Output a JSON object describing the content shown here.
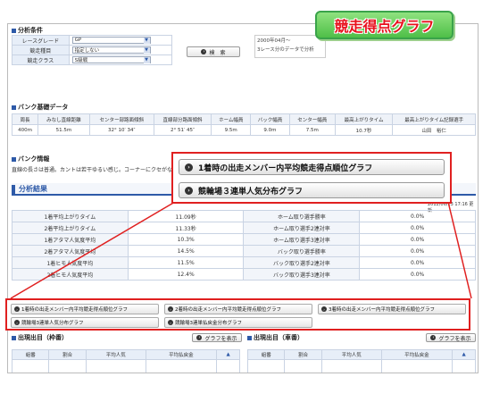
{
  "badge": "競走得点グラフ",
  "sections": {
    "analysis_cond": "分析条件",
    "bank_data": "バンク基礎データ",
    "bank_info": "バンク情報",
    "analysis_result": "分析結果"
  },
  "conditions": [
    {
      "label": "レースグレード",
      "value": "GP"
    },
    {
      "label": "競走種目",
      "value": "指定しない"
    },
    {
      "label": "競走クラス",
      "value": "S級戦"
    }
  ],
  "search_btn": "検　索",
  "period": {
    "line1": "2000年04月〜",
    "line2": "3レース分のデータで分析"
  },
  "bank": {
    "headers": [
      "周長",
      "みなし直線距離",
      "センター部路面傾斜",
      "直線部分路面傾斜",
      "ホーム幅員",
      "バック幅員",
      "センター幅員",
      "最高上がりタイム",
      "最高上がりタイム記録選手"
    ],
    "values": [
      "400m",
      "51.5m",
      "32° 10′ 34″",
      "2° 51′ 45″",
      "9.5m",
      "9.0m",
      "7.5m",
      "10.7秒",
      "山田　裕仁"
    ]
  },
  "bank_info_text": "直線の長さは普通。カントは若干ゆるい感じ。コーナーにクセがない",
  "updated": "2012/06/13 17:16 更新",
  "result_rows": [
    [
      "1着平均上がりタイム",
      "11.09秒",
      "ホーム取り選手勝率",
      "0.0%"
    ],
    [
      "2着平均上がりタイム",
      "11.33秒",
      "ホーム取り選手2連対率",
      "0.0%"
    ],
    [
      "1着アタマ人気度平均",
      "10.3%",
      "ホーム取り選手3連対率",
      "0.0%"
    ],
    [
      "2着アタマ人気度平均",
      "14.5%",
      "バック取り選手勝率",
      "0.0%"
    ],
    [
      "1着ヒモ人気度平均",
      "11.5%",
      "バック取り選手2連対率",
      "0.0%"
    ],
    [
      "2着ヒモ人気度平均",
      "12.4%",
      "バック取り選手3連対率",
      "0.0%"
    ]
  ],
  "popup_buttons": [
    "1着時の出走メンバー内平均競走得点順位グラフ",
    "競輪場３連単人気分布グラフ"
  ],
  "graph_buttons": [
    "1着時の出走メンバー内平均競走得点順位グラフ",
    "2着時の出走メンバー内平均競走得点順位グラフ",
    "3着時の出走メンバー内平均競走得点順位グラフ",
    "競輪場3連単人気分布グラフ",
    "競輪場3連単払戻金分布グラフ"
  ],
  "exit_left": {
    "title": "出現出目（枠番）",
    "btn": "グラフを表示",
    "cols": [
      "組番",
      "割合",
      "平均人気",
      "平均払戻金"
    ]
  },
  "exit_right": {
    "title": "出現出目（車番）",
    "btn": "グラフを表示",
    "cols": [
      "組番",
      "割合",
      "平均人気",
      "平均払戻金"
    ]
  },
  "icons": {
    "button_dot": "circle-arrow-icon",
    "select_arrow": "chevron-down-icon",
    "scroll_arrow": "chevron-up-icon"
  },
  "colors": {
    "accent": "#2e5aa8",
    "highlight": "#e02020",
    "badge_text": "#e8101d",
    "badge_bg": "#4fbf48"
  }
}
